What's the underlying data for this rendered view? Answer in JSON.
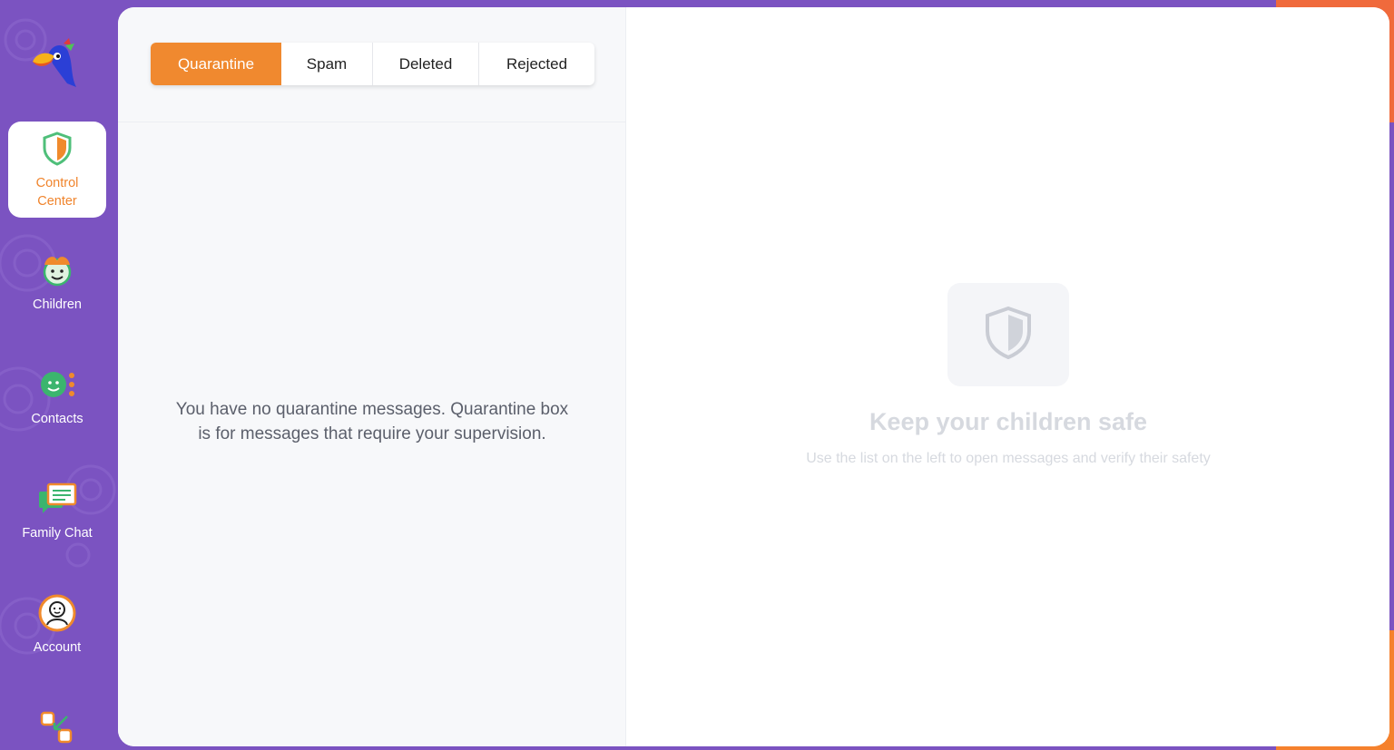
{
  "colors": {
    "sidebar_bg": "#7b53c1",
    "accent_orange": "#f0892f",
    "active_label": "#f0842c"
  },
  "sidebar": {
    "items": [
      {
        "label": "Control\nCenter",
        "icon": "shield-icon",
        "active": true
      },
      {
        "label": "Children",
        "icon": "children-face-icon",
        "active": false
      },
      {
        "label": "Contacts",
        "icon": "contacts-face-icon",
        "active": false
      },
      {
        "label": "Family Chat",
        "icon": "chat-bubbles-icon",
        "active": false
      },
      {
        "label": "Account",
        "icon": "account-avatar-icon",
        "active": false
      }
    ],
    "bottom_icon": "switch-apps-icon",
    "logo_icon": "toucan-logo-icon"
  },
  "tabs": [
    {
      "label": "Quarantine",
      "active": true
    },
    {
      "label": "Spam",
      "active": false
    },
    {
      "label": "Deleted",
      "active": false
    },
    {
      "label": "Rejected",
      "active": false
    }
  ],
  "list": {
    "empty_message": "You have no quarantine messages. Quarantine box is for messages that require your supervision."
  },
  "detail": {
    "icon": "shield-icon",
    "title": "Keep your children safe",
    "subtitle": "Use the list on the left to open messages and verify their safety"
  }
}
